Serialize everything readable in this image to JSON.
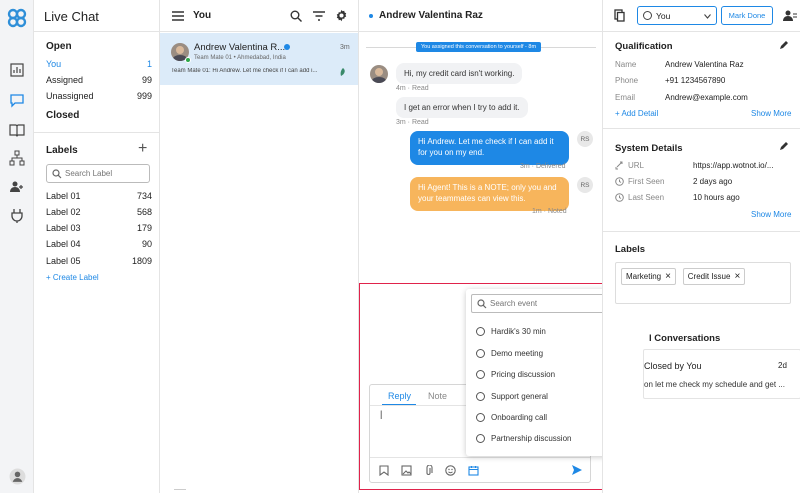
{
  "nav": {
    "title": "Live Chat",
    "open_heading": "Open",
    "open_items": [
      {
        "label": "You",
        "count": "1"
      },
      {
        "label": "Assigned",
        "count": "99"
      },
      {
        "label": "Unassigned",
        "count": "999"
      }
    ],
    "closed_heading": "Closed",
    "labels_heading": "Labels",
    "labels_add": "+",
    "search_placeholder": "Search Label",
    "labels": [
      {
        "label": "Label 01",
        "count": "734"
      },
      {
        "label": "Label 02",
        "count": "568"
      },
      {
        "label": "Label 03",
        "count": "179"
      },
      {
        "label": "Label 04",
        "count": "90"
      },
      {
        "label": "Label 05",
        "count": "1809"
      }
    ],
    "create_label": "+ Create Label"
  },
  "list": {
    "header": "You",
    "item": {
      "name": "Andrew Valentina R...",
      "time": "3m",
      "subtitle": "Team Mate 01 • Ahmedabad, India",
      "preview": "Team Mate 01: Hi Andrew. Let me check if I can add i..."
    }
  },
  "conversation": {
    "contact_name": "Andrew Valentina Raz",
    "assignee": "You",
    "mark_done": "Mark Done",
    "system_note": "You assigned this conversation to yourself - 8m",
    "messages": [
      {
        "text": "Hi, my credit card isn't working.",
        "meta": "4m · Read"
      },
      {
        "text": "I get an error when I try to add it.",
        "meta": "3m · Read"
      },
      {
        "text": "Hi Andrew. Let me check if I can add it for you on my end.",
        "meta": "3m · Delivered",
        "avatar": "RS"
      },
      {
        "text": "Hi Agent! This is a NOTE; only you and your teammates can view this.",
        "meta": "1m · Noted",
        "avatar": "RS"
      }
    ],
    "composer": {
      "tab_reply": "Reply",
      "tab_note": "Note",
      "cursor": "|"
    }
  },
  "event_dropdown": {
    "search_placeholder": "Search event",
    "items": [
      "Hardik's 30 min",
      "Demo meeting",
      "Pricing discussion",
      "Support general",
      "Onboarding call",
      "Partnership discussion"
    ]
  },
  "details": {
    "qualification_title": "Qualification",
    "qualification": [
      {
        "label": "Name",
        "value": "Andrew Valentina Raz"
      },
      {
        "label": "Phone",
        "value": "+91 1234567890"
      },
      {
        "label": "Email",
        "value": "Andrew@example.com"
      }
    ],
    "add_detail": "+ Add Detail",
    "show_more": "Show More",
    "system_title": "System Details",
    "system": [
      {
        "label": "URL",
        "value": "https://app.wotnot.io/..."
      },
      {
        "label": "First Seen",
        "value": "2 days ago"
      },
      {
        "label": "Last Seen",
        "value": "10 hours ago"
      }
    ],
    "labels_title": "Labels",
    "labels": [
      "Marketing",
      "Credit Issue"
    ],
    "past_title": "l Conversations",
    "past_item_title": "Closed by You",
    "past_item_time": "2d",
    "past_item_preview": "on let me check my schedule and get ..."
  },
  "colors": {
    "accent": "#1e88e5",
    "agent_bubble": "#1e88e5",
    "note_bubble": "#f7b55c",
    "highlight_border": "#e0234b",
    "selected_item": "#dcebf9"
  }
}
